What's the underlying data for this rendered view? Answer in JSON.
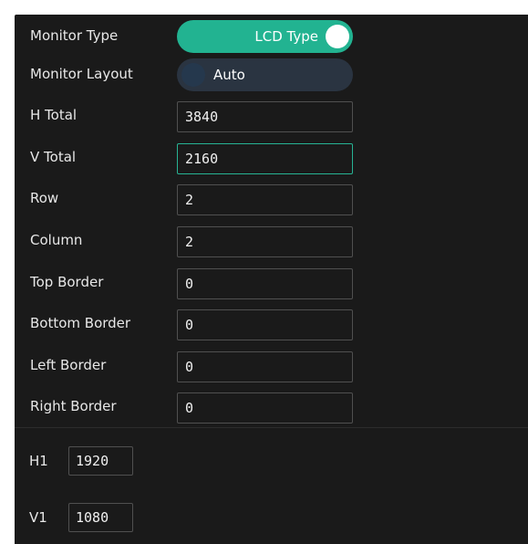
{
  "monitor_type": {
    "label": "Monitor Type",
    "value": "LCD Type"
  },
  "monitor_layout": {
    "label": "Monitor Layout",
    "value": "Auto"
  },
  "fields": [
    {
      "label": "H Total",
      "value": "3840"
    },
    {
      "label": "V Total",
      "value": "2160"
    },
    {
      "label": "Row",
      "value": "2"
    },
    {
      "label": "Column",
      "value": "2"
    },
    {
      "label": "Top Border",
      "value": "0"
    },
    {
      "label": "Bottom Border",
      "value": "0"
    },
    {
      "label": "Left Border",
      "value": "0"
    },
    {
      "label": "Right Border",
      "value": "0"
    }
  ],
  "splits": [
    {
      "label": "H1",
      "value": "1920"
    },
    {
      "label": "V1",
      "value": "1080"
    }
  ],
  "colors": {
    "panel_bg": "#1a1a1a",
    "accent": "#22b391",
    "toggle_off_bg": "#2a3441",
    "field_border": "#505050",
    "text": "#e8e8e8"
  }
}
